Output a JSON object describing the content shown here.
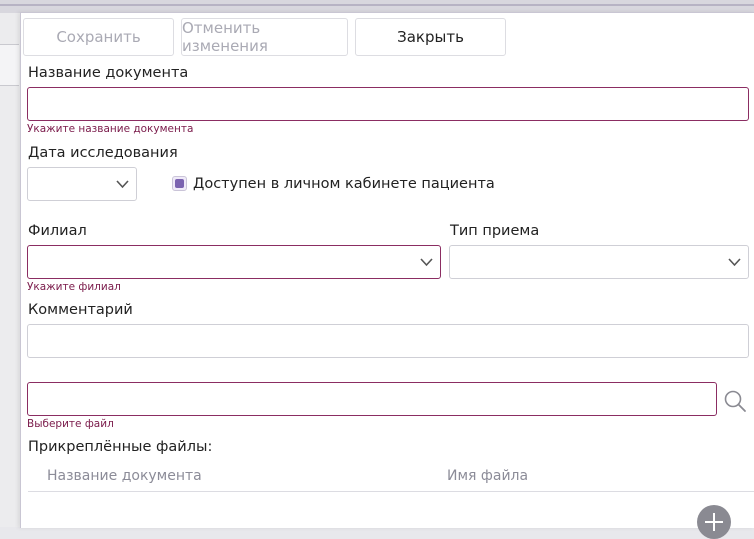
{
  "toolbar": {
    "save_label": "Сохранить",
    "cancel_label": "Отменить изменения",
    "close_label": "Закрыть"
  },
  "form": {
    "doc_name": {
      "label": "Название документа",
      "value": "",
      "hint": "Укажите название документа"
    },
    "study_date": {
      "label": "Дата исследования",
      "value": ""
    },
    "patient_visible": {
      "label": "Доступен в личном кабинете пациента",
      "checked": true
    },
    "branch": {
      "label": "Филиал",
      "value": "",
      "hint": "Укажите филиал"
    },
    "visit_type": {
      "label": "Тип приема",
      "value": ""
    },
    "comment": {
      "label": "Комментарий",
      "value": ""
    },
    "file": {
      "value": "",
      "hint": "Выберите файл"
    }
  },
  "attachments": {
    "title": "Прикреплённые файлы:",
    "columns": [
      "Название документа",
      "Имя файла"
    ],
    "rows": []
  },
  "colors": {
    "accent": "#7b63b0",
    "invalid_border": "#8b2d62",
    "hint_text": "#7a1a4a"
  },
  "icons": {
    "date_dropdown": "chevron-down-icon",
    "search": "search-icon",
    "add": "plus-icon"
  }
}
